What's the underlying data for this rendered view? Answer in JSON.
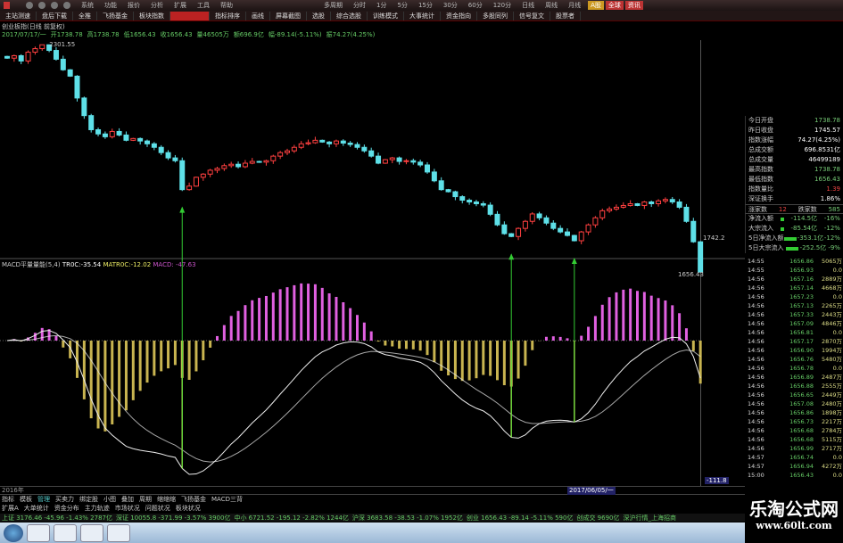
{
  "menu": {
    "items": [
      "系统",
      "功能",
      "报价",
      "分析",
      "扩展",
      "工具",
      "帮助"
    ],
    "periods": [
      "多周期",
      "分时",
      "1分",
      "5分",
      "15分",
      "30分",
      "60分",
      "120分",
      "日线",
      "周线",
      "月线"
    ],
    "buttons": [
      "A股",
      "全球",
      "资讯"
    ]
  },
  "tabs": [
    "主站测速",
    "盘后下载",
    "全推",
    "飞扬基金",
    "板块指数",
    "",
    "指标排序",
    "画线",
    "屏幕截图",
    "选股",
    "综合选股",
    "训练模式",
    "大事统计",
    "资金指向",
    "多股同列",
    "信号复文",
    "股票者"
  ],
  "chart": {
    "title": "创业板指(日线 前复权)",
    "info": [
      "2017/07/17/一",
      "开1738.78",
      "高1738.78",
      "低1656.43",
      "收1656.43",
      "量46505万",
      "额696.9亿",
      "幅-89.14(-5.11%)",
      "振74.27(4.25%)"
    ],
    "max_label": "2301.55",
    "min_label": "1656.43",
    "last_label": "1742.2",
    "colors": {
      "up": "#ff4040",
      "down": "#5ee0e8",
      "arrow": "#3c3",
      "dif": "#eeeeee",
      "dea": "#eeeeee",
      "hist_pos": "#e060e0",
      "hist_neg": "#c8b450",
      "signal": "#ffee55"
    },
    "closes": [
      2263,
      2270,
      2255,
      2280,
      2290,
      2301,
      2285,
      2260,
      2230,
      2212,
      2150,
      2100,
      2060,
      2048,
      2040,
      2055,
      2045,
      2030,
      2035,
      2028,
      2020,
      2010,
      1995,
      1980,
      1972,
      1890,
      1900,
      1925,
      1934,
      1945,
      1950,
      1958,
      1962,
      1955,
      1965,
      1970,
      1968,
      1972,
      1985,
      1995,
      2000,
      2010,
      2020,
      2023,
      2030,
      2025,
      2020,
      2028,
      2022,
      2018,
      2010,
      2000,
      1985,
      1965,
      1975,
      1980,
      1970,
      1972,
      1968,
      1960,
      1940,
      1915,
      1890,
      1884,
      1870,
      1860,
      1855,
      1850,
      1846,
      1820,
      1790,
      1765,
      1757,
      1780,
      1800,
      1821,
      1810,
      1795,
      1780,
      1770,
      1760,
      1745,
      1770,
      1790,
      1810,
      1830,
      1835,
      1840,
      1845,
      1850,
      1845,
      1855,
      1850,
      1858,
      1862,
      1855,
      1840,
      1800,
      1742,
      1656
    ],
    "signal_indices": [
      25,
      72,
      81
    ]
  },
  "macd": {
    "header": "MACD平量量能(5,4)",
    "troc": "TR0C:-35.54",
    "matroc": "MATR0C:-12.02",
    "macd": "MACD: -47.63",
    "axis_label": "-111.8"
  },
  "panel": {
    "stats": [
      [
        "今日开盘",
        "1738.78",
        ""
      ],
      [
        "昨日收盘",
        "1745.57",
        "w"
      ],
      [
        "指数涨幅",
        "74.27(4.25%)",
        "w"
      ],
      [
        "总成交额",
        "696.8531亿",
        "w"
      ],
      [
        "总成交量",
        "46499189",
        "w"
      ],
      [
        "最高指数",
        "1738.78",
        ""
      ],
      [
        "最低指数",
        "1656.43",
        ""
      ],
      [
        "指数量比",
        "1.39",
        "r"
      ],
      [
        "深证换手",
        "1.86%",
        "w"
      ]
    ],
    "updown": {
      "up_label": "涨家数",
      "up": "12",
      "down_label": "跌家数",
      "down": "585"
    },
    "flows": [
      [
        "净流入额",
        "-114.5亿",
        "-16%"
      ],
      [
        "大宗流入",
        "-85.54亿",
        "-12%"
      ],
      [
        "5日净流入额",
        "-353.1亿",
        "-12%"
      ],
      [
        "5日大宗流入",
        "-252.5亿",
        "-9%"
      ]
    ],
    "ticks": [
      [
        "14:55",
        "1656.86",
        "5065万"
      ],
      [
        "14:55",
        "1656.93",
        "0.0"
      ],
      [
        "14:56",
        "1657.16",
        "2889万"
      ],
      [
        "14:56",
        "1657.14",
        "4668万"
      ],
      [
        "14:56",
        "1657.23",
        "0.0"
      ],
      [
        "14:56",
        "1657.13",
        "2265万"
      ],
      [
        "14:56",
        "1657.33",
        "2443万"
      ],
      [
        "14:56",
        "1657.09",
        "4846万"
      ],
      [
        "14:56",
        "1656.81",
        "0.0"
      ],
      [
        "14:56",
        "1657.17",
        "2870万"
      ],
      [
        "14:56",
        "1656.90",
        "1994万"
      ],
      [
        "14:56",
        "1656.76",
        "5480万"
      ],
      [
        "14:56",
        "1656.78",
        "0.0"
      ],
      [
        "14:56",
        "1656.89",
        "2487万"
      ],
      [
        "14:56",
        "1656.88",
        "2555万"
      ],
      [
        "14:56",
        "1656.65",
        "2449万"
      ],
      [
        "14:56",
        "1657.08",
        "2480万"
      ],
      [
        "14:56",
        "1656.86",
        "1898万"
      ],
      [
        "14:56",
        "1656.73",
        "2217万"
      ],
      [
        "14:56",
        "1656.68",
        "2784万"
      ],
      [
        "14:56",
        "1656.68",
        "5115万"
      ],
      [
        "14:56",
        "1656.99",
        "2717万"
      ],
      [
        "14:57",
        "1656.74",
        "0.0"
      ],
      [
        "14:57",
        "1656.94",
        "4272万"
      ],
      [
        "15:00",
        "1656.43",
        "0.0"
      ]
    ]
  },
  "dateaxis": {
    "start": "2016年",
    "cursor": "2017/06/05/一"
  },
  "bottom": {
    "tabs": [
      "指标",
      "模板",
      "管理",
      "买卖力",
      "绑定股",
      "小图",
      "叠加",
      "周期",
      "缩缩缩",
      "飞扬基金",
      "MACD三背"
    ],
    "tabs2": [
      "扩展A",
      "大单统计",
      "资金分布",
      "主力轨迹",
      "市场状况",
      "问题状况",
      "板块状况"
    ],
    "status": [
      "上证 3176.46 -45.96 -1.43% 2787亿",
      "深证 10055.8 -371.99 -3.57% 3900亿",
      "中小 6721.52 -195.12 -2.82% 1244亿",
      "沪深 3683.58 -38.53 -1.07% 1952亿",
      "创业 1656.43 -89.14 -5.11% 590亿",
      "创成交 9690亿",
      "深沪行情_上海招商"
    ]
  },
  "watermark": {
    "cn": "乐淘公式网",
    "en": "www.60lt.com"
  }
}
